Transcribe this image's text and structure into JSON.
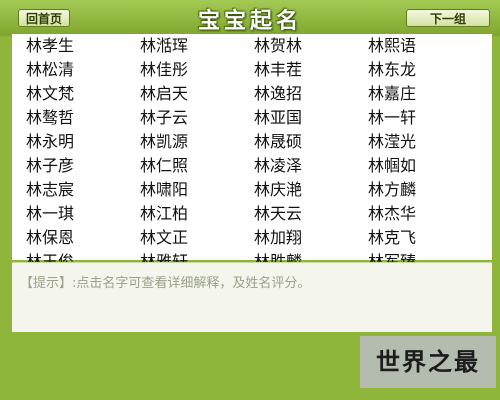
{
  "header": {
    "prev_label": "回首页",
    "title": "宝宝起名",
    "next_label": "下一组"
  },
  "names": [
    [
      "林孝生",
      "林湉珲",
      "林贺林",
      "林熙语"
    ],
    [
      "林松清",
      "林佳彤",
      "林丰茬",
      "林东龙"
    ],
    [
      "林文梵",
      "林启天",
      "林逸招",
      "林嘉庄"
    ],
    [
      "林骜哲",
      "林子云",
      "林亚国",
      "林一轩"
    ],
    [
      "林永明",
      "林凯源",
      "林晟硕",
      "林滢光"
    ],
    [
      "林子彦",
      "林仁照",
      "林凌泽",
      "林帼如"
    ],
    [
      "林志宸",
      "林啸阳",
      "林庆滟",
      "林方麟"
    ],
    [
      "林一琪",
      "林江柏",
      "林天云",
      "林杰华"
    ],
    [
      "林保恩",
      "林文正",
      "林加翔",
      "林克飞"
    ],
    [
      "林玉俊",
      "林雅轩",
      "林胜麟",
      "林军臻"
    ]
  ],
  "tip": {
    "text": "【提示】:点击名字可查看详细解释，及姓名评分。"
  },
  "brand": {
    "text": "世界之最"
  }
}
